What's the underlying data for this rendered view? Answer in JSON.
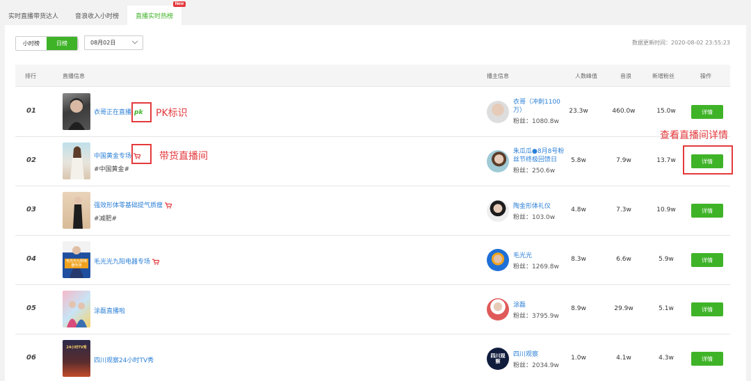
{
  "tabs": [
    {
      "label": "实时直播带货达人"
    },
    {
      "label": "音浪收入小时榜"
    },
    {
      "label": "直播实时热榜",
      "badge": "New"
    }
  ],
  "toolbar": {
    "hourly_label": "小时榜",
    "daily_label": "日榜",
    "date_value": "08月02日",
    "update_time": "数据更新时间：2020-08-02 23:55:23"
  },
  "table": {
    "headers": [
      "排行",
      "直播信息",
      "播主信息",
      "人数峰值",
      "音浪",
      "新增粉丝",
      "操作"
    ],
    "rows": [
      {
        "rank": "01",
        "title": "衣哥正在直播",
        "tag": "",
        "type": "pk",
        "pk": "pk",
        "anchor": "衣哥（冲刺1100万）",
        "fans": "粉丝：1080.8w",
        "peak": "23.3w",
        "wave": "460.0w",
        "new_fans": "15.0w",
        "action": "详情"
      },
      {
        "rank": "02",
        "title": "中国黄金专场",
        "tag": "#中国黄金#",
        "type": "cart",
        "anchor": "朱瓜瓜●8月8号粉丝节终极回馈日",
        "fans": "粉丝：250.6w",
        "peak": "5.8w",
        "wave": "7.9w",
        "new_fans": "13.7w",
        "action": "详情"
      },
      {
        "rank": "03",
        "title": "强效形体零基础提气质瘦",
        "tag": "#减肥#",
        "type": "cart",
        "anchor": "陶金形体礼仪",
        "fans": "粉丝：103.0w",
        "peak": "4.8w",
        "wave": "7.3w",
        "new_fans": "10.9w",
        "action": "详情"
      },
      {
        "rank": "04",
        "title": "毛光光九阳电器专场",
        "tag": "",
        "type": "cart",
        "anchor": "毛光光",
        "fans": "粉丝：1269.8w",
        "peak": "8.3w",
        "wave": "6.6w",
        "new_fans": "5.9w",
        "action": "详情"
      },
      {
        "rank": "05",
        "title": "涂磊直播啦",
        "tag": "",
        "type": "none",
        "anchor": "涂磊",
        "fans": "粉丝：3795.9w",
        "peak": "8.9w",
        "wave": "29.9w",
        "new_fans": "5.1w",
        "action": "详情"
      },
      {
        "rank": "06",
        "title": "四川观察24小时TV秀",
        "tag": "",
        "type": "none",
        "anchor": "四川观察",
        "fans": "粉丝：2034.9w",
        "peak": "1.0w",
        "wave": "4.1w",
        "new_fans": "4.3w",
        "action": "详情"
      }
    ]
  },
  "annotations": {
    "pk_label": "PK标识",
    "cart_label": "带货直播间",
    "detail_label": "查看直播间详情"
  },
  "thumb_texts": {
    "row4_banner": "毛光光九阳电器专场",
    "row6_banner": "24小时TV秀",
    "row6_logo": "四川观察"
  },
  "colors": {
    "accent_green": "#3fb328",
    "link_blue": "#2a7fd6",
    "annotation_red": "#e4393c"
  }
}
